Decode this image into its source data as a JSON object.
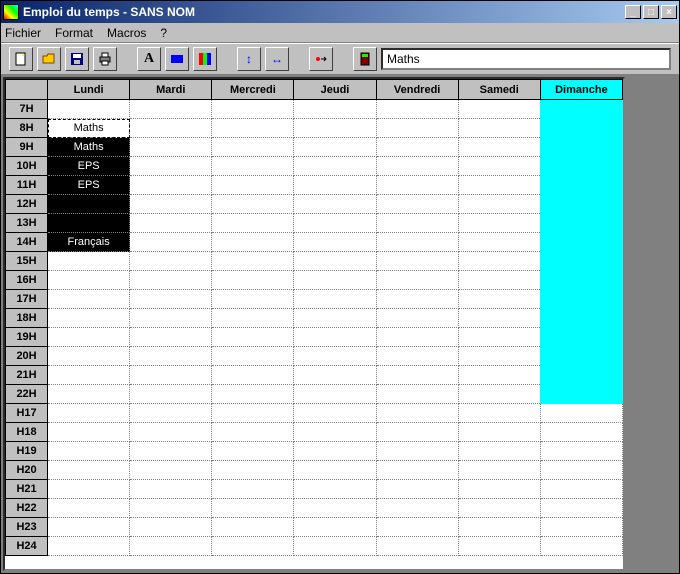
{
  "window": {
    "title": "Emploi du temps - SANS NOM"
  },
  "menu": {
    "items": [
      "Fichier",
      "Format",
      "Macros",
      "?"
    ]
  },
  "toolbar": {
    "icons": {
      "new": "new-doc-icon",
      "open": "open-folder-icon",
      "save": "save-disk-icon",
      "print": "print-icon",
      "font": "font-icon",
      "color1": "color-icon",
      "color2": "palette-icon",
      "vresize": "vresize-icon",
      "hresize": "hresize-icon",
      "tool1": "tool-icon",
      "tool2": "calc-icon"
    },
    "input_value": "Maths"
  },
  "grid": {
    "days": [
      "Lundi",
      "Mardi",
      "Mercredi",
      "Jeudi",
      "Vendredi",
      "Samedi",
      "Dimanche"
    ],
    "rows": [
      "7H",
      "8H",
      "9H",
      "10H",
      "11H",
      "12H",
      "13H",
      "14H",
      "15H",
      "16H",
      "17H",
      "18H",
      "19H",
      "20H",
      "21H",
      "22H",
      "H17",
      "H18",
      "H19",
      "H20",
      "H21",
      "H22",
      "H23",
      "H24"
    ],
    "cells": {
      "Lundi": {
        "8H": {
          "text": "Maths",
          "style": "sel"
        },
        "9H": {
          "text": "Maths",
          "style": "black"
        },
        "10H": {
          "text": "EPS",
          "style": "black"
        },
        "11H": {
          "text": "EPS",
          "style": "black"
        },
        "12H": {
          "text": "",
          "style": "black"
        },
        "13H": {
          "text": "",
          "style": "black"
        },
        "14H": {
          "text": "Français",
          "style": "black"
        }
      }
    },
    "cyan_column": "Dimanche",
    "cyan_rows": [
      "7H",
      "8H",
      "9H",
      "10H",
      "11H",
      "12H",
      "13H",
      "14H",
      "15H",
      "16H",
      "17H",
      "18H",
      "19H",
      "20H",
      "21H",
      "22H"
    ]
  }
}
